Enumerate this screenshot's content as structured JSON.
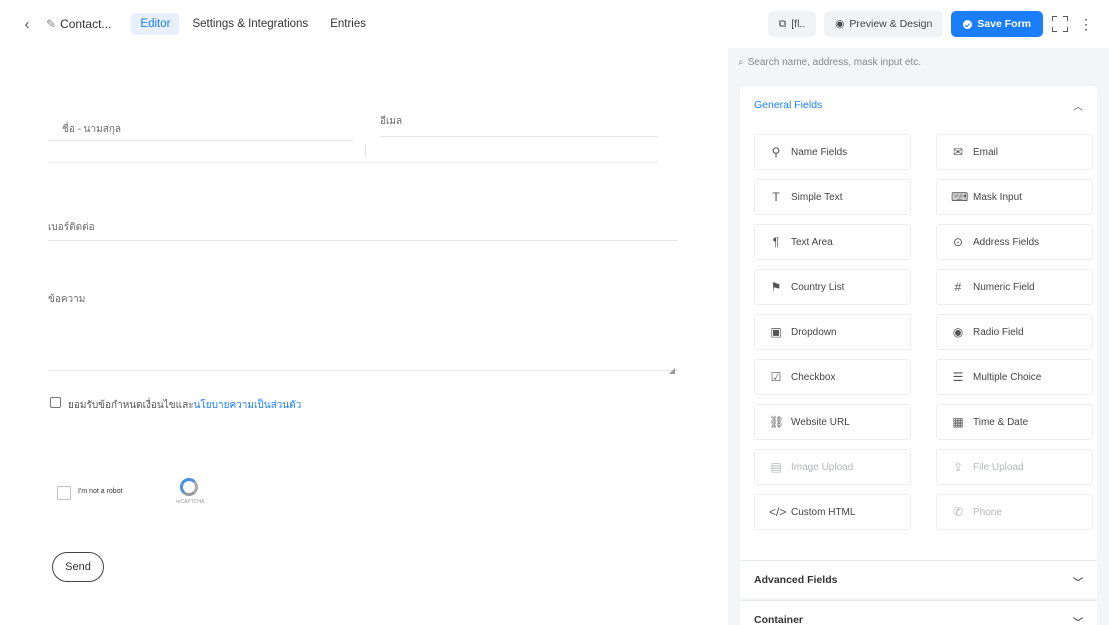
{
  "topbar": {
    "back_icon": "chevron-left-icon",
    "form_title": "Contact...",
    "tabs": [
      {
        "label": "Editor",
        "active": true
      },
      {
        "label": "Settings & Integrations",
        "active": false
      },
      {
        "label": "Entries",
        "active": false
      }
    ],
    "shortcode_label": "[fl..",
    "preview_label": "Preview & Design",
    "save_label": "Save Form",
    "accent_color": "#1a7efb"
  },
  "form": {
    "first_name_label": "ชื่อ - นามสกุล",
    "email_label": "อีเมล",
    "phone_label": "เบอร์ติดต่อ",
    "message_label": "ข้อความ",
    "consent_text": "ยอมรับข้อกำหนดเงื่อนไขและ",
    "consent_link": "นโยบายความเป็นส่วนตัว",
    "recaptcha_text": "I'm not a robot",
    "recaptcha_sub": "reCAPTCHA",
    "send_label": "Send"
  },
  "panel": {
    "search_placeholder": "Search name, address, mask input etc.",
    "general_title": "General Fields",
    "fields": [
      {
        "label": "Name Fields",
        "icon": "user-icon",
        "enabled": true
      },
      {
        "label": "Email",
        "icon": "email-icon",
        "enabled": true
      },
      {
        "label": "Simple Text",
        "icon": "text-icon",
        "enabled": true
      },
      {
        "label": "Mask Input",
        "icon": "keyboard-icon",
        "enabled": true
      },
      {
        "label": "Text Area",
        "icon": "paragraph-icon",
        "enabled": true
      },
      {
        "label": "Address Fields",
        "icon": "location-icon",
        "enabled": true
      },
      {
        "label": "Country List",
        "icon": "flag-icon",
        "enabled": true
      },
      {
        "label": "Numeric Field",
        "icon": "hash-icon",
        "enabled": true
      },
      {
        "label": "Dropdown",
        "icon": "dropdown-icon",
        "enabled": true
      },
      {
        "label": "Radio Field",
        "icon": "radio-icon",
        "enabled": true
      },
      {
        "label": "Checkbox",
        "icon": "checkbox-icon",
        "enabled": true
      },
      {
        "label": "Multiple Choice",
        "icon": "list-icon",
        "enabled": true
      },
      {
        "label": "Website URL",
        "icon": "link-icon",
        "enabled": true
      },
      {
        "label": "Time & Date",
        "icon": "calendar-icon",
        "enabled": true
      },
      {
        "label": "Image Upload",
        "icon": "image-icon",
        "enabled": false
      },
      {
        "label": "File Upload",
        "icon": "upload-icon",
        "enabled": false
      },
      {
        "label": "Custom HTML",
        "icon": "code-icon",
        "enabled": true
      },
      {
        "label": "Phone",
        "icon": "phone-icon",
        "enabled": false
      }
    ],
    "advanced_title": "Advanced Fields",
    "container_title": "Container"
  }
}
